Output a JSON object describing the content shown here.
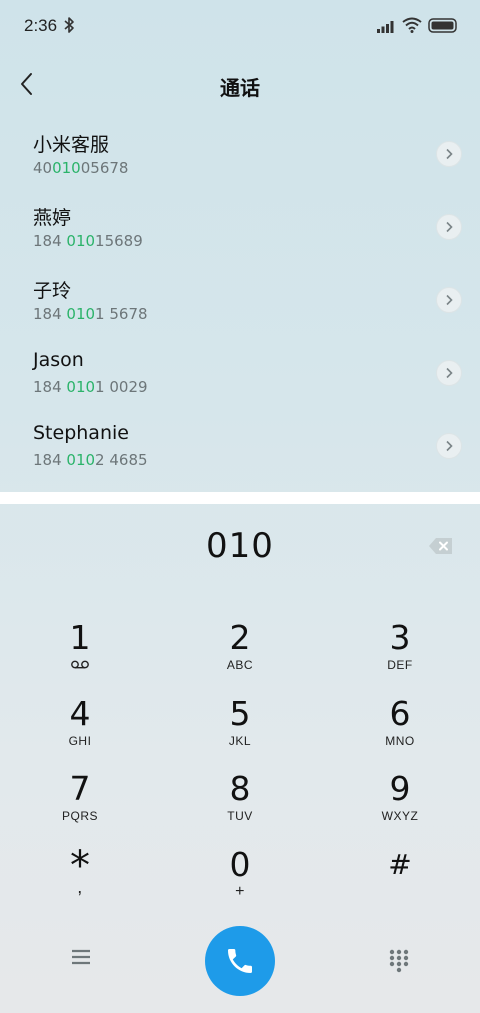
{
  "status_bar": {
    "time": "2:36"
  },
  "header": {
    "title": "通话"
  },
  "contacts": [
    {
      "name": "小米客服",
      "number_pre": "40",
      "number_match": "010",
      "number_post": "05678"
    },
    {
      "name": "燕婷",
      "number_pre": "184 ",
      "number_match": "010",
      "number_post": "15689"
    },
    {
      "name": "子玲",
      "number_pre": "184 ",
      "number_match": "010",
      "number_post": "1 5678"
    },
    {
      "name": "Jason",
      "number_pre": "184 ",
      "number_match": "010",
      "number_post": "1 0029"
    },
    {
      "name": "Stephanie",
      "number_pre": "184 ",
      "number_match": "010",
      "number_post": "2 4685"
    }
  ],
  "dialer": {
    "number": "010",
    "keys": [
      {
        "digit": "1",
        "letters": ""
      },
      {
        "digit": "2",
        "letters": "ABC"
      },
      {
        "digit": "3",
        "letters": "DEF"
      },
      {
        "digit": "4",
        "letters": "GHI"
      },
      {
        "digit": "5",
        "letters": "JKL"
      },
      {
        "digit": "6",
        "letters": "MNO"
      },
      {
        "digit": "7",
        "letters": "PQRS"
      },
      {
        "digit": "8",
        "letters": "TUV"
      },
      {
        "digit": "9",
        "letters": "WXYZ"
      },
      {
        "digit": "*",
        "letters": ","
      },
      {
        "digit": "0",
        "letters": "+"
      },
      {
        "digit": "#",
        "letters": ""
      }
    ]
  },
  "colors": {
    "accent": "#1e9be9",
    "match_highlight": "#2bb36a"
  },
  "icons": [
    "bluetooth-icon",
    "signal-icon",
    "wifi-icon",
    "battery-icon",
    "back-arrow-icon",
    "chevron-right-icon",
    "backspace-icon",
    "voicemail-icon",
    "menu-icon",
    "phone-icon",
    "dialpad-icon"
  ]
}
